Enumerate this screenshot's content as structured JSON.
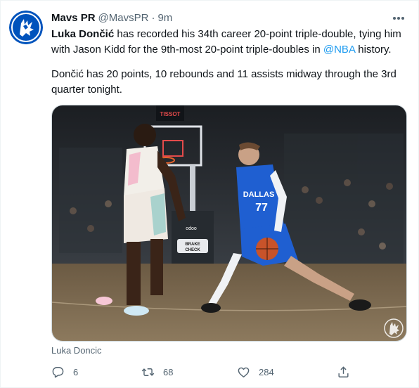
{
  "tweet": {
    "author_name": "Mavs PR",
    "author_handle": "@MavsPR",
    "separator": "·",
    "time": "9m",
    "text_bold_name": "Luka Dončić",
    "text_line1": " has recorded his 34th career 20-point triple-double, tying him with Jason Kidd for the 9th-most 20-point triple-doubles in ",
    "text_mention": "@NBA",
    "text_line1_end": " history.",
    "text_paragraph2": "Dončić has 20 points, 10 rebounds and 11 assists midway through the 3rd quarter tonight.",
    "media_caption": "Luka Doncic",
    "photo_text": {
      "scoreboard": "TISSOT",
      "jersey_text": "DALLAS",
      "jersey_number": "77",
      "ad_text": "odoo",
      "sign_line1": "BRAKE",
      "sign_line2": "CHECK"
    },
    "actions": {
      "reply_count": "6",
      "retweet_count": "68",
      "like_count": "284"
    }
  },
  "colors": {
    "accent": "#1d9bf0",
    "secondary_text": "#536471",
    "primary_text": "#0f1419",
    "mavs_blue": "#0053bc"
  },
  "icons": {
    "avatar": "mavs-logo-icon",
    "more": "more-dots-icon",
    "reply": "reply-icon",
    "retweet": "retweet-icon",
    "like": "heart-icon",
    "share": "share-icon",
    "watermark": "mavs-logo-watermark-icon"
  }
}
